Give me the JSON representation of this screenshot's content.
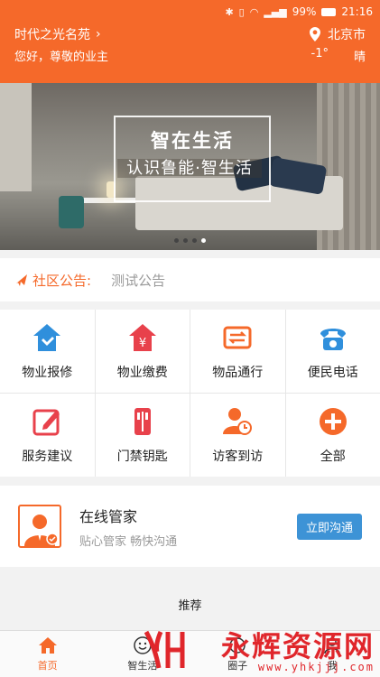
{
  "status_bar": {
    "battery": "99%",
    "time": "21:16"
  },
  "header": {
    "community": "时代之光名苑",
    "greeting": "您好，尊敬的业主",
    "city": "北京市",
    "temperature": "-1°",
    "weather": "晴"
  },
  "banner": {
    "title": "智在生活",
    "subtitle": "认识鲁能·智生活"
  },
  "notice": {
    "label": "社区公告:",
    "text": "测试公告"
  },
  "services": [
    {
      "label": "物业报修",
      "icon": "house-repair-icon",
      "color": "#2f8fdc"
    },
    {
      "label": "物业缴费",
      "icon": "house-payment-icon",
      "color": "#e8414b"
    },
    {
      "label": "物品通行",
      "icon": "goods-pass-icon",
      "color": "#f5692a"
    },
    {
      "label": "便民电话",
      "icon": "phone-icon",
      "color": "#2f8fdc"
    },
    {
      "label": "服务建议",
      "icon": "feedback-icon",
      "color": "#e8414b"
    },
    {
      "label": "门禁钥匙",
      "icon": "door-key-icon",
      "color": "#e8414b"
    },
    {
      "label": "访客到访",
      "icon": "visitor-icon",
      "color": "#f5692a"
    },
    {
      "label": "全部",
      "icon": "plus-circle-icon",
      "color": "#f5692a"
    }
  ],
  "butler": {
    "title": "在线管家",
    "subtitle": "贴心管家  畅快沟通",
    "button": "立即沟通"
  },
  "recommend": "推荐",
  "tabs": [
    {
      "label": "首页",
      "icon": "home-icon",
      "active": true
    },
    {
      "label": "智生活",
      "icon": "smile-icon",
      "active": false
    },
    {
      "label": "圈子",
      "icon": "circle-icon",
      "active": false
    },
    {
      "label": "我",
      "icon": "person-icon",
      "active": false
    }
  ],
  "watermark": {
    "brand": "永辉资源网",
    "url": "www.yhkjjj.com"
  },
  "colors": {
    "accent": "#f5692a",
    "blue": "#3d93d6"
  }
}
